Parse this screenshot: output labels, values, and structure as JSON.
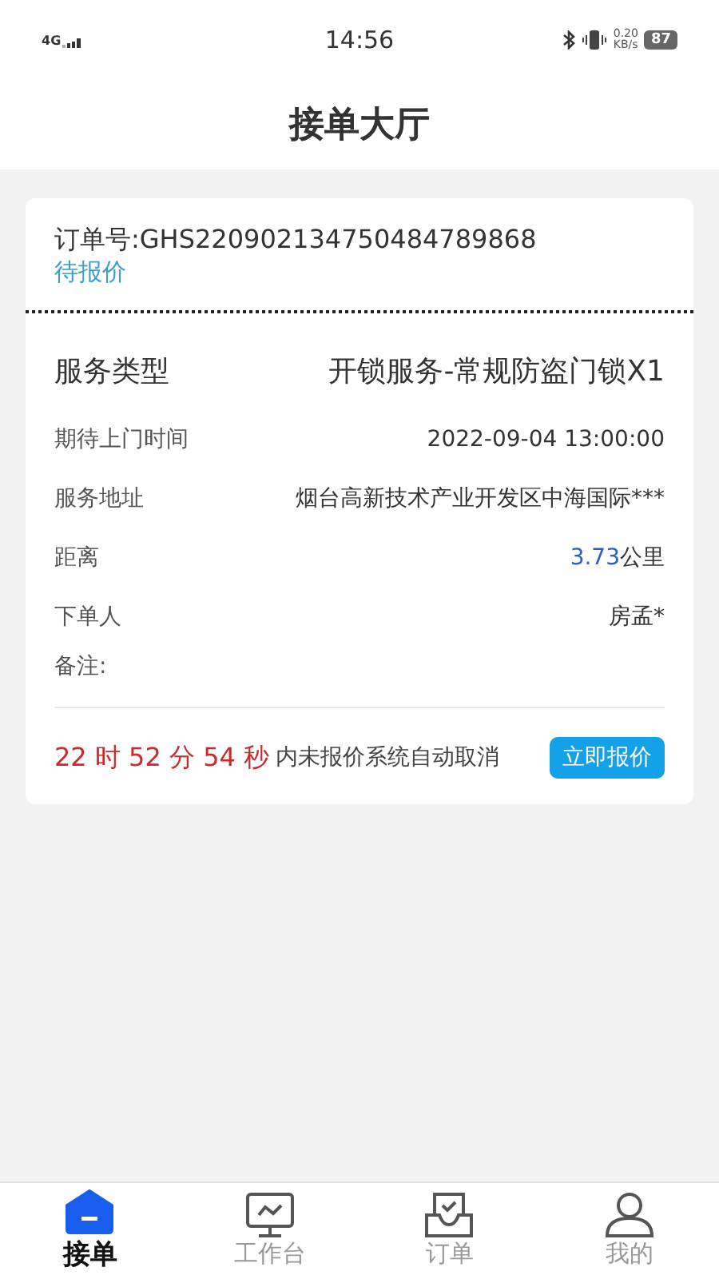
{
  "status_bar": {
    "network": "4G",
    "time": "14:56",
    "speed_value": "0.20",
    "speed_unit": "KB/s",
    "battery": "87"
  },
  "header": {
    "title": "接单大厅"
  },
  "order": {
    "number": "订单号:GHS220902134750484789868",
    "status": "待报价",
    "rows": [
      {
        "kind": "main",
        "label": "服务类型",
        "value": "开锁服务-常规防盗门锁X1"
      },
      {
        "kind": "plain",
        "label": "期待上门时间",
        "value": "2022-09-04 13:00:00"
      },
      {
        "kind": "plain",
        "label": "服务地址",
        "value": "烟台高新技术产业开发区中海国际***"
      },
      {
        "kind": "distance",
        "label": "距离",
        "value": "3.73",
        "unit": "公里"
      },
      {
        "kind": "plain",
        "label": "下单人",
        "value": "房孟*"
      },
      {
        "kind": "note",
        "label": "备注:"
      }
    ],
    "countdown": "22 时 52 分 54 秒",
    "notice": "内未报价系统自动取消",
    "button": "立即报价"
  },
  "tabs": [
    {
      "label": "接单",
      "selected": true
    },
    {
      "label": "工作台",
      "selected": false
    },
    {
      "label": "订单",
      "selected": false
    },
    {
      "label": "我的",
      "selected": false
    }
  ]
}
